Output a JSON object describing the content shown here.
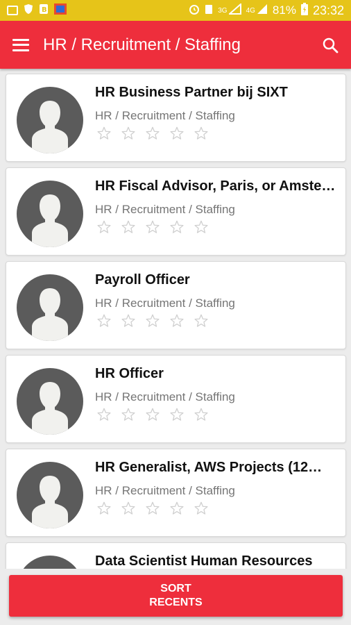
{
  "status_bar": {
    "network_label": "3G",
    "network2_label": "4G",
    "battery_percent": "81%",
    "time": "23:32",
    "icons": [
      "gallery-icon",
      "shield-icon",
      "b-icon",
      "flag-icon",
      "alarm-icon",
      "battery-saver-icon",
      "signal-icon",
      "signal-2-icon",
      "battery-icon"
    ]
  },
  "app_bar": {
    "title": "HR / Recruitment / Staffing",
    "menu_icon": "hamburger-icon",
    "search_icon": "search-icon"
  },
  "jobs": [
    {
      "title": "HR Business Partner bij SIXT",
      "category": "HR / Recruitment / Staffing",
      "rating": 0
    },
    {
      "title": "HR Fiscal Advisor, Paris, or Amste…",
      "category": "HR / Recruitment / Staffing",
      "rating": 0
    },
    {
      "title": "Payroll Officer",
      "category": "HR / Recruitment / Staffing",
      "rating": 0
    },
    {
      "title": "HR Officer",
      "category": "HR / Recruitment / Staffing",
      "rating": 0
    },
    {
      "title": "HR Generalist, AWS Projects (12…",
      "category": "HR / Recruitment / Staffing",
      "rating": 0
    },
    {
      "title": "Data Scientist Human Resources",
      "category": "",
      "rating": 0
    }
  ],
  "sort_button": {
    "line1": "SORT",
    "line2": "RECENTS"
  },
  "colors": {
    "status_bar": "#e6c419",
    "primary": "#ee2e3c",
    "avatar_bg": "#5b5b5b",
    "star_outline": "#cfcfcf"
  }
}
